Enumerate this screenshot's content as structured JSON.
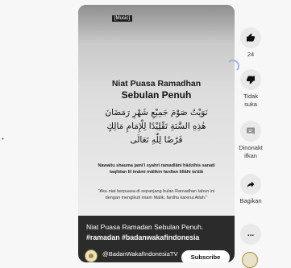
{
  "video": {
    "music_tag": "[Music]",
    "card_title_1": "Niat Puasa Ramadhan",
    "card_title_2": "Sebulan Penuh",
    "arabic_lines": [
      "نَوَيْتُ صَوْمَ جَمِيْعِ شَهْرِ رَمَضَانَ",
      "هٰذِهِ السَّنَةِ تَقْلِيْدًا لِلْإِمَامِ مَالِكٍ",
      "فَرْضًا لِلّٰهِ تَعَالَى"
    ],
    "latin": "Nawaitu shauma jami'i syahri ramadlāni hādzihis sanati taqlīdan lil imāmi mālikin fardlan lillāhi ta'ālā",
    "meaning": "\"Aku niat berpuasa di sepanjang bulan Ramadhan tahun ini dengan mengikuti imam Malik, fardhu karena Allah.\"",
    "caption": "Niat Puasa Ramadan Sebulan Penuh.",
    "hashtags": "#ramadan #badanwakafindonesia",
    "channel_name": "@BadanWakafIndonesiaTV",
    "subscribe_label": "Subscribe"
  },
  "actions": {
    "like_count": "24",
    "dislike_label": "Tidak suka",
    "comment_label": "Dinonaktifkan",
    "share_label": "Bagikan",
    "more_label": "..."
  },
  "icons": [
    "thumbs-up-icon",
    "thumbs-down-icon",
    "comment-icon",
    "share-icon",
    "more-icon"
  ]
}
